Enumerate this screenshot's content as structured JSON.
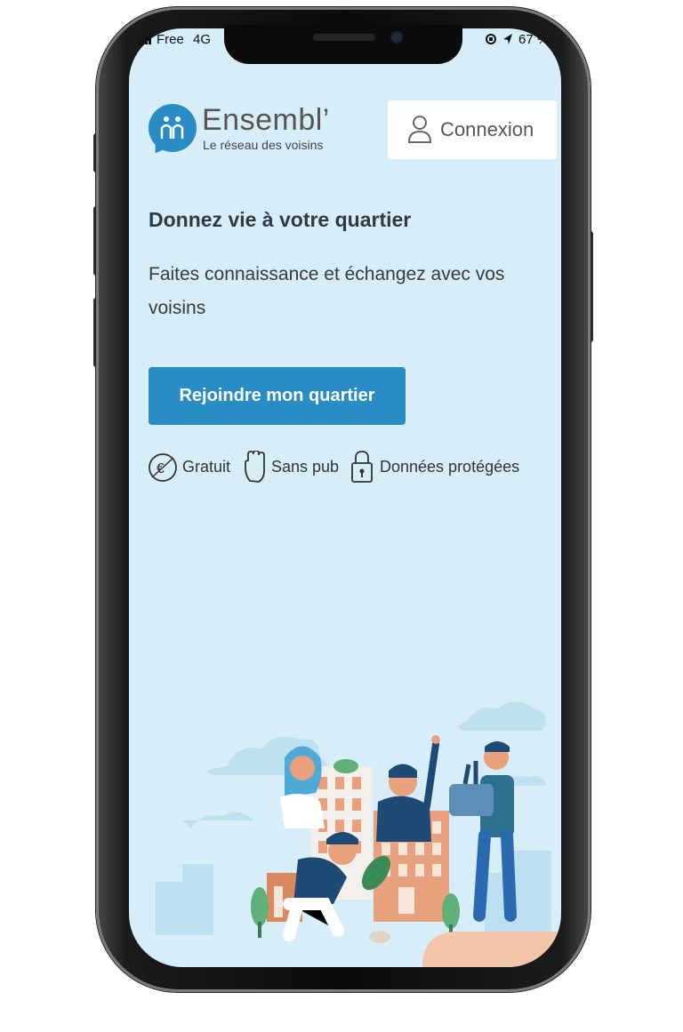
{
  "status_bar": {
    "carrier": "Free",
    "network": "4G",
    "battery": "67 %"
  },
  "logo": {
    "title": "Ensembl’",
    "subtitle": "Le réseau des voisins"
  },
  "header": {
    "login_label": "Connexion"
  },
  "main": {
    "headline": "Donnez vie à votre quartier",
    "subline": "Faites connaissance et échangez avec vos voisins",
    "cta_label": "Rejoindre mon quartier",
    "features": [
      {
        "label": "Gratuit",
        "icon": "euro-icon"
      },
      {
        "label": "Sans pub",
        "icon": "hand-icon"
      },
      {
        "label": "Données protégées",
        "icon": "lock-icon"
      }
    ]
  },
  "colors": {
    "brand": "#2a8cc4",
    "background": "#d7eef8",
    "illustration_orange": "#e9a07d",
    "illustration_navy": "#1f4a75"
  }
}
